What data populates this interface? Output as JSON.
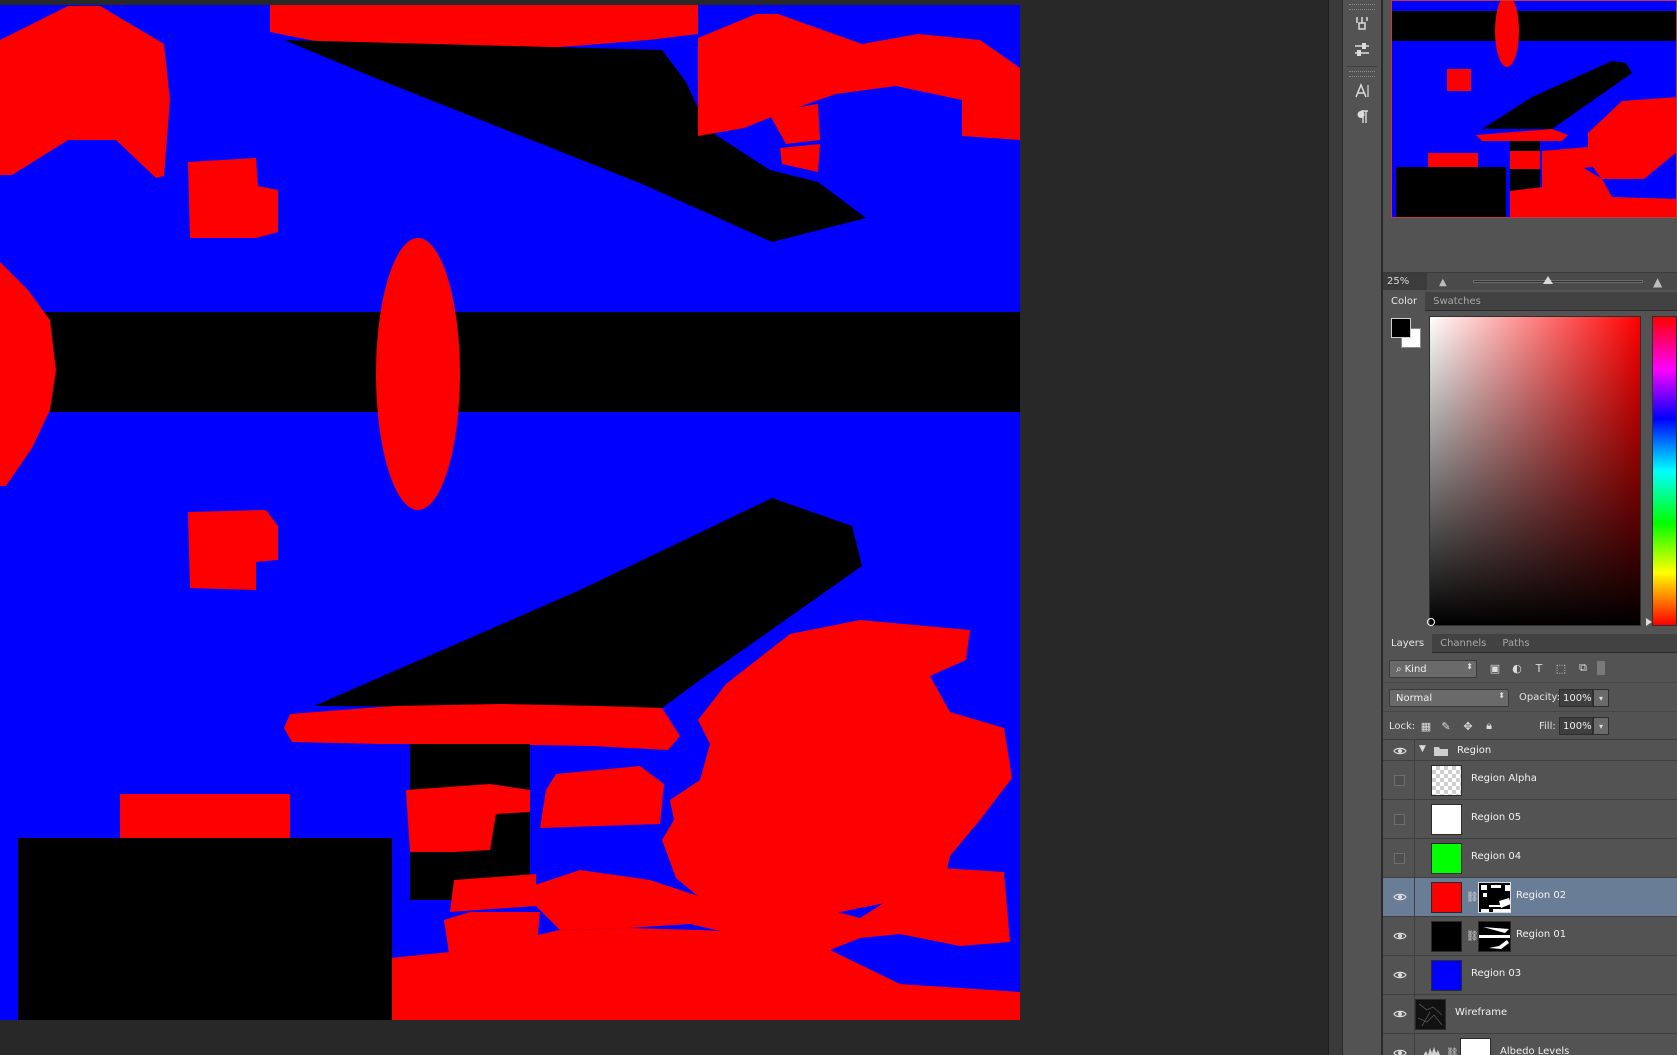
{
  "navigator": {
    "zoom": "25%"
  },
  "color_panel": {
    "tabs": [
      "Color",
      "Swatches"
    ],
    "foreground": "#000000",
    "background": "#ffffff"
  },
  "layers_panel": {
    "tabs": [
      "Layers",
      "Channels",
      "Paths"
    ],
    "filter_kind": "Kind",
    "blend_mode": "Normal",
    "opacity_label": "Opacity:",
    "opacity": "100%",
    "lock_label": "Lock:",
    "fill_label": "Fill:",
    "fill": "100%",
    "layers": [
      {
        "name": "Region",
        "type": "group",
        "visible": true
      },
      {
        "name": "Region Alpha",
        "visible": false,
        "thumb": "transparent"
      },
      {
        "name": "Region 05",
        "visible": false,
        "thumb": "#ffffff"
      },
      {
        "name": "Region 04",
        "visible": false,
        "thumb": "#00ff00"
      },
      {
        "name": "Region 02",
        "visible": true,
        "thumb": "#ff0000",
        "mask": true,
        "selected": true
      },
      {
        "name": "Region 01",
        "visible": true,
        "thumb": "#000000",
        "mask": true
      },
      {
        "name": "Region 03",
        "visible": true,
        "thumb": "#0000ff"
      },
      {
        "name": "Wireframe",
        "visible": true,
        "thumb": "wireframe"
      },
      {
        "name": "Albedo Levels",
        "visible": true,
        "thumb": "#ffffff",
        "adjustment": true
      }
    ]
  },
  "colors": {
    "canvas_blue": "#0000ff",
    "canvas_red": "#ff0000",
    "canvas_black": "#000000",
    "selection": "#6a7d97"
  }
}
